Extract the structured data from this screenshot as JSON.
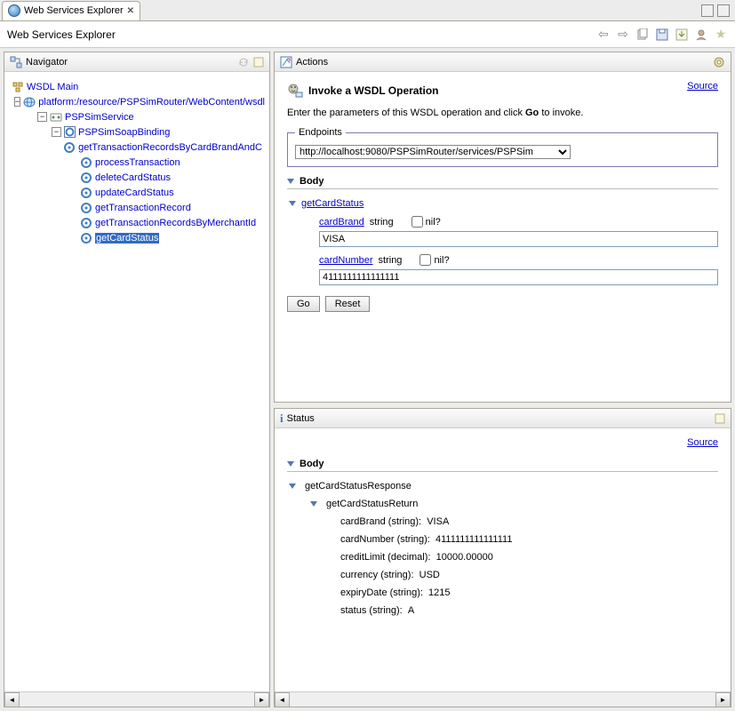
{
  "tab": {
    "title": "Web Services Explorer"
  },
  "toolbar": {
    "title": "Web Services Explorer"
  },
  "navigator": {
    "title": "Navigator",
    "root": "WSDL Main",
    "service_node": "platform:/resource/PSPSimRouter/WebContent/wsdl",
    "service_child": "PSPSimService",
    "binding": "PSPSimSoapBinding",
    "operations": [
      "getTransactionRecordsByCardBrandAndC",
      "processTransaction",
      "deleteCardStatus",
      "updateCardStatus",
      "getTransactionRecord",
      "getTransactionRecordsByMerchantId",
      "getCardStatus"
    ],
    "selected_index": 6
  },
  "actions": {
    "title": "Actions",
    "heading": "Invoke a WSDL Operation",
    "source": "Source",
    "instructions_pre": "Enter the parameters of this WSDL operation and click ",
    "instructions_bold": "Go",
    "instructions_post": " to invoke.",
    "endpoints_legend": "Endpoints",
    "endpoint_value": "http://localhost:9080/PSPSimRouter/services/PSPSim",
    "body_label": "Body",
    "operation": "getCardStatus",
    "fields": [
      {
        "name": "cardBrand",
        "type": "string",
        "nil_label": "nil?",
        "value": "VISA"
      },
      {
        "name": "cardNumber",
        "type": "string",
        "nil_label": "nil?",
        "value": "4111111111111111"
      }
    ],
    "go": "Go",
    "reset": "Reset"
  },
  "status": {
    "title": "Status",
    "source": "Source",
    "body_label": "Body",
    "response_name": "getCardStatusResponse",
    "return_name": "getCardStatusReturn",
    "fields": [
      {
        "label": "cardBrand (string):",
        "value": "VISA"
      },
      {
        "label": "cardNumber (string):",
        "value": "4111111111111111"
      },
      {
        "label": "creditLimit (decimal):",
        "value": "10000.00000"
      },
      {
        "label": "currency (string):",
        "value": "USD"
      },
      {
        "label": "expiryDate (string):",
        "value": "1215"
      },
      {
        "label": "status (string):",
        "value": "A"
      }
    ]
  }
}
